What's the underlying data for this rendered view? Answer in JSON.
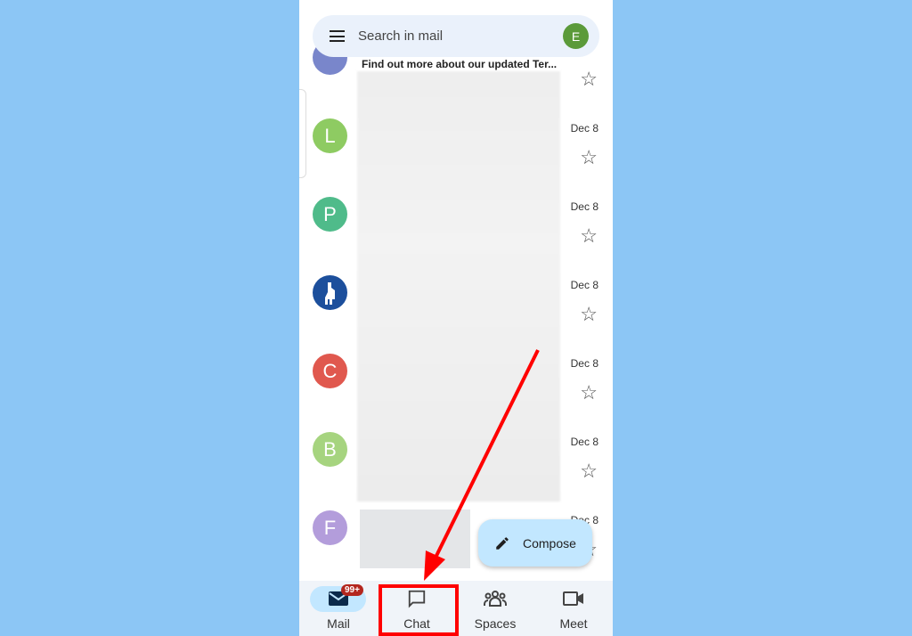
{
  "search": {
    "placeholder": "Search in mail",
    "account_initial": "E"
  },
  "partial_row": {
    "text": "Find out more about our updated Ter..."
  },
  "emails": [
    {
      "initial": "L",
      "color": "#8ecb62",
      "date": "Dec 8"
    },
    {
      "initial": "P",
      "color": "#4fbb8a",
      "date": "Dec 8"
    },
    {
      "initial": "",
      "color": "#1c4f9c",
      "date": "Dec 8"
    },
    {
      "initial": "C",
      "color": "#e0584e",
      "date": "Dec 8"
    },
    {
      "initial": "B",
      "color": "#a6d47f",
      "date": "Dec 8"
    },
    {
      "initial": "F",
      "color": "#b39ddb",
      "date": "Dec 8"
    }
  ],
  "compose": {
    "label": "Compose"
  },
  "nav": {
    "mail": "Mail",
    "mail_badge": "99+",
    "chat": "Chat",
    "spaces": "Spaces",
    "meet": "Meet"
  },
  "annotation": {
    "color": "#ff0000"
  }
}
